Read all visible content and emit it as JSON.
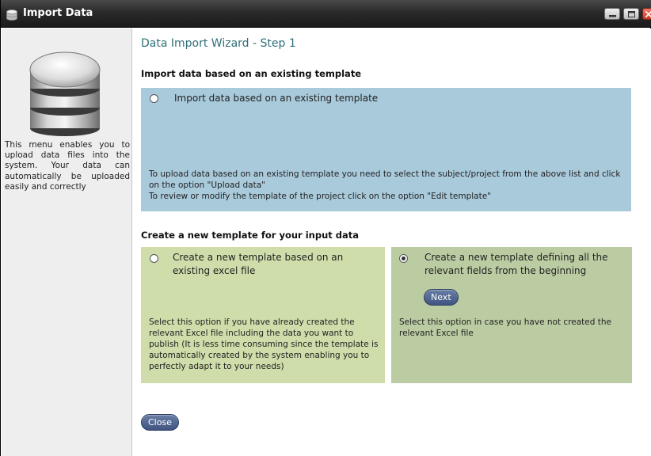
{
  "window": {
    "title": "Import Data",
    "controls": {
      "minimize_icon": "minimize-icon",
      "maximize_icon": "maximize-icon",
      "close_icon": "close-icon"
    }
  },
  "sidebar": {
    "icon": "database-icon",
    "description": "This menu enables you to upload data files into the system. Your data can automatically be uploaded easily and correctly"
  },
  "main": {
    "wizard_title": "Data Import Wizard - Step 1",
    "existing_section": {
      "heading": "Import data based on an existing template",
      "option_label": "Import data based on an existing template",
      "selected": false,
      "help_line1": "To upload data based on an existing template you need to select the subject/project from the above list and click on the option \"Upload data\"",
      "help_line2": "To review or modify the template of the project click on the option \"Edit template\""
    },
    "new_section": {
      "heading": "Create a new template for your input data",
      "excel_option": {
        "label": "Create a new template based on an existing excel file",
        "selected": false,
        "help": "Select this option if you have already created the relevant Excel file including the data you want to publish (It is less time consuming since the template is automatically created by the system enabling you to perfectly adapt it to your needs)"
      },
      "manual_option": {
        "label": "Create a new template defining all the relevant fields from the beginning",
        "selected": true,
        "next_label": "Next",
        "help": "Select this option in case you have not created the relevant Excel file"
      }
    },
    "close_label": "Close"
  },
  "colors": {
    "title_text": "#2f6f7a",
    "blue_panel": "#a9cadb",
    "green_panel_left": "#cfddaa",
    "green_panel_right": "#bbcca2",
    "button": "#4a5f8a"
  }
}
